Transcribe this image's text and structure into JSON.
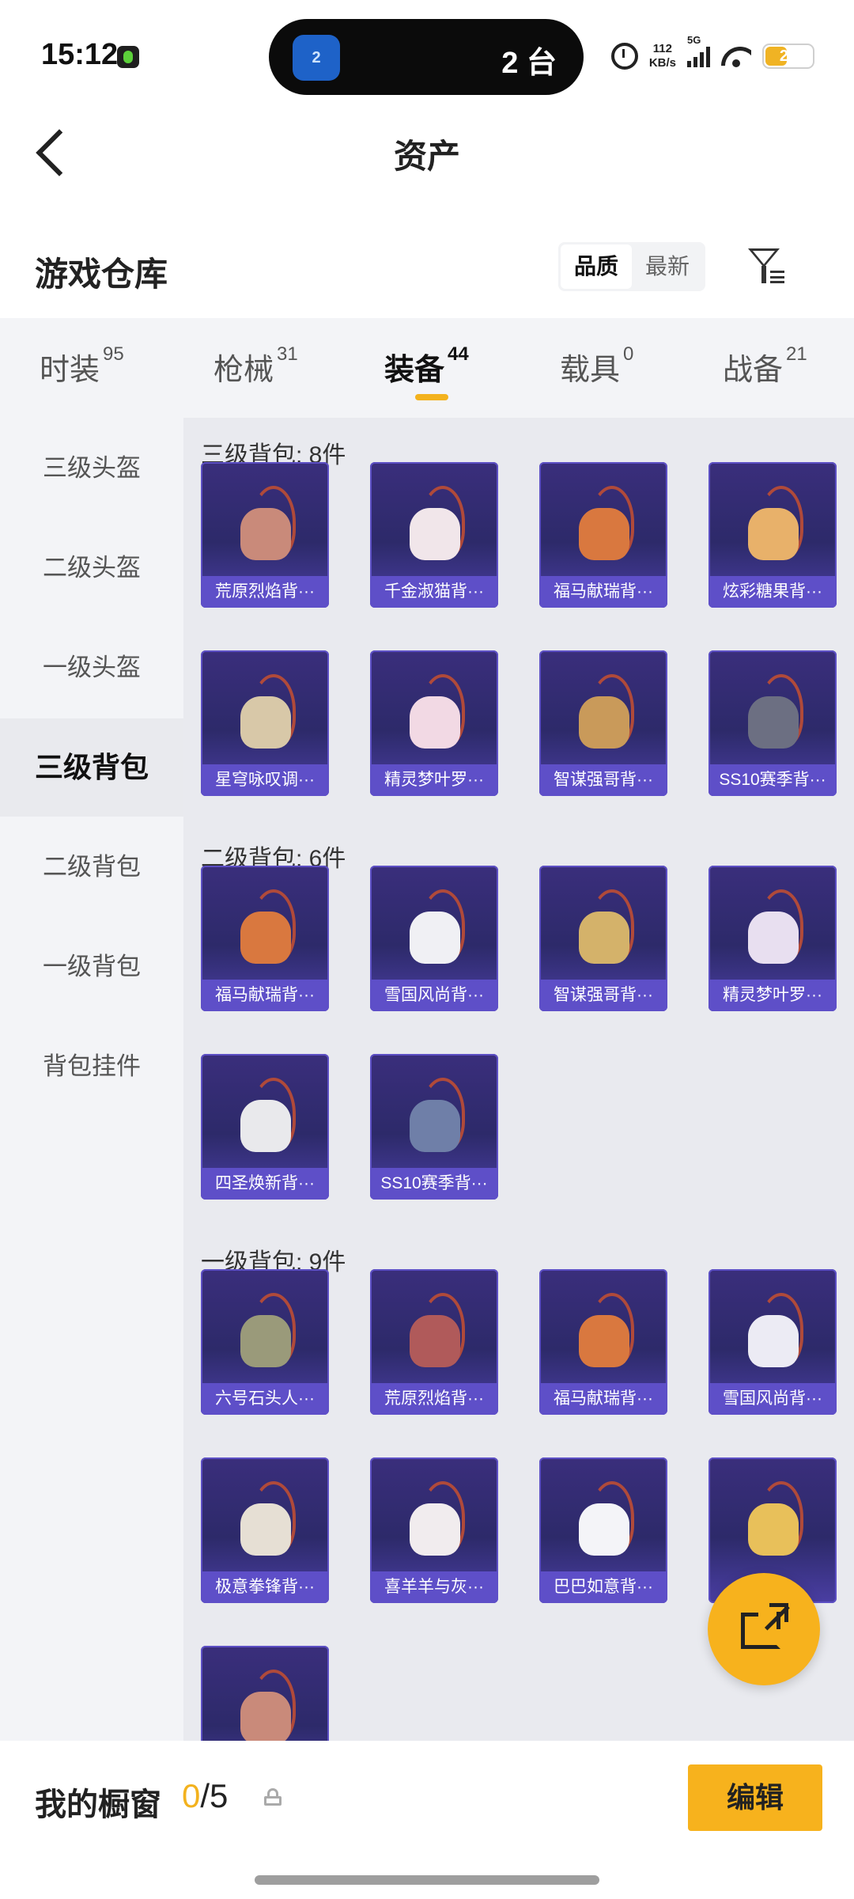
{
  "status_bar": {
    "time": "15:12",
    "island_icon_label": "2",
    "island_text": "2 台",
    "net_speed_value": "112",
    "net_speed_unit": "KB/s",
    "network_type": "5G",
    "battery_level": "23",
    "battery_color": "#f0b324"
  },
  "header": {
    "title": "资产",
    "back_icon": "chevron-left-icon"
  },
  "warehouse": {
    "title": "游戏仓库",
    "sort_options": [
      "品质",
      "最新"
    ],
    "sort_selected": "品质",
    "filter_icon": "filter-icon"
  },
  "tabs": [
    {
      "label": "时装",
      "count": "95",
      "active": false
    },
    {
      "label": "枪械",
      "count": "31",
      "active": false
    },
    {
      "label": "装备",
      "count": "44",
      "active": true
    },
    {
      "label": "载具",
      "count": "0",
      "active": false
    },
    {
      "label": "战备",
      "count": "21",
      "active": false
    }
  ],
  "categories": [
    {
      "label": "三级头盔",
      "active": false
    },
    {
      "label": "二级头盔",
      "active": false
    },
    {
      "label": "一级头盔",
      "active": false
    },
    {
      "label": "三级背包",
      "active": true
    },
    {
      "label": "二级背包",
      "active": false
    },
    {
      "label": "一级背包",
      "active": false
    },
    {
      "label": "背包挂件",
      "active": false
    }
  ],
  "sections": [
    {
      "title": "三级背包: 8件",
      "items": [
        "荒原烈焰背···",
        "千金淑猫背···",
        "福马献瑞背···",
        "炫彩糖果背···",
        "星穹咏叹调···",
        "精灵梦叶罗···",
        "智谋强哥背···",
        "SS10赛季背···"
      ]
    },
    {
      "title": "二级背包: 6件",
      "items": [
        "福马献瑞背···",
        "雪国风尚背···",
        "智谋强哥背···",
        "精灵梦叶罗···",
        "四圣焕新背···",
        "SS10赛季背···"
      ]
    },
    {
      "title": "一级背包: 9件",
      "items": [
        "六号石头人···",
        "荒原烈焰背···",
        "福马献瑞背···",
        "雪国风尚背···",
        "极意拳锋背···",
        "喜羊羊与灰···",
        "巴巴如意背···",
        "",
        ""
      ]
    }
  ],
  "fab": {
    "icon": "share-external-icon",
    "color": "#f7b21d"
  },
  "bottom_bar": {
    "showcase_label": "我的橱窗",
    "showcase_current": "0",
    "showcase_total": "/5",
    "lock_icon": "lock-icon",
    "edit_label": "编辑",
    "accent_color": "#f7b21d"
  }
}
